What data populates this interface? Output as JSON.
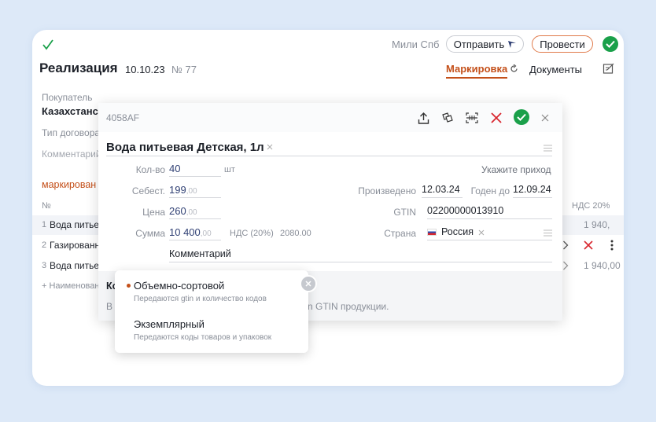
{
  "header": {
    "company": "Мили Спб",
    "send_label": "Отправить",
    "post_label": "Провести",
    "title": "Реализация",
    "date": "10.10.23",
    "number": "№ 77",
    "tab_marking": "Маркировка",
    "tab_documents": "Документы"
  },
  "form": {
    "buyer_label": "Покупатель",
    "buyer_value": "Казахстанс",
    "contract_label": "Тип договора",
    "comment_placeholder": "Комментарий"
  },
  "table": {
    "section_label": "маркирован",
    "col_no": "№",
    "col_vat": "НДС 20%",
    "rows": [
      {
        "no": "1",
        "name": "Вода питье",
        "vat": "1 940,"
      },
      {
        "no": "2",
        "name": "Газированн",
        "vat": ""
      },
      {
        "no": "3",
        "name": "Вода питье",
        "vat": "1 940,00"
      }
    ],
    "add_label": "+ Наименован"
  },
  "modal": {
    "code": "4058AF",
    "product_name": "Вода питьевая Детская, 1л",
    "qty_label": "Кол-во",
    "qty_value": "40",
    "qty_unit": "шт",
    "cost_label": "Себест.",
    "cost_int": "199",
    "cost_dec": ",00",
    "price_label": "Цена",
    "price_int": "260",
    "price_dec": ",00",
    "sum_label": "Сумма",
    "sum_int": "10 400",
    "sum_dec": ",00",
    "vat_label": "НДС (20%)",
    "vat_value": "2080.00",
    "comment": "Комментарий",
    "income_link": "Укажите приход",
    "produced_label": "Произведено",
    "produced_value": "12.03.24",
    "expiry_label": "Годен до",
    "expiry_value": "12.09.24",
    "gtin_label": "GTIN",
    "gtin_value": "02200000013910",
    "country_label": "Страна",
    "country_value": "Россия",
    "bottom_title": "Ко",
    "bottom_text_start": "В",
    "bottom_text_end": "n GTIN продукции."
  },
  "popup": {
    "options": [
      {
        "title": "Объемно-сортовой",
        "desc": "Передаются gtin и количество кодов",
        "selected": true
      },
      {
        "title": "Экземплярный",
        "desc": "Передаются коды товаров и упаковок",
        "selected": false
      }
    ]
  },
  "colors": {
    "accent": "#c4501a",
    "success": "#1aa04a",
    "danger": "#d8272f",
    "link": "#2f3f73"
  }
}
